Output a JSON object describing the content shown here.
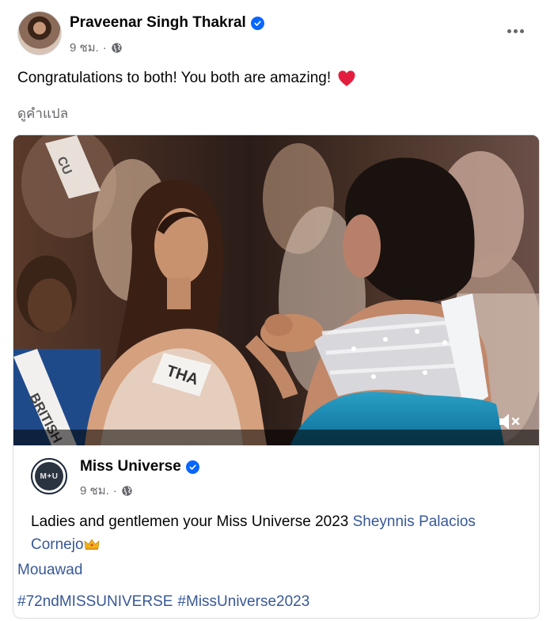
{
  "post": {
    "author": "Praveenar Singh Thakral",
    "time": "9 ชม.",
    "separator": "·",
    "text": "Congratulations to both! You both are amazing!",
    "translate_label": "ดูคำแปล"
  },
  "shared": {
    "author": "Miss Universe",
    "logo_text": "M+U",
    "time": "9 ชม.",
    "separator": "·",
    "text_plain": "Ladies and gentlemen your Miss Universe 2023 ",
    "link_name_part1": "Sheynnis Palacios",
    "link_name_part2": "Cornejo",
    "link_mouawad": "Mouawad",
    "hashtags": [
      "#72ndMISSUNIVERSE",
      "#MissUniverse2023"
    ]
  },
  "video": {
    "sash_left_text": "BRITISH",
    "sash_center_text": "THA",
    "sash_top_text": "CU"
  },
  "colors": {
    "verified_blue": "#0866ff",
    "link_blue": "#385898",
    "heart_red": "#e41e3f",
    "meta_gray": "#65676b"
  },
  "icons": {
    "verified": "verified-badge-icon",
    "globe": "globe-icon",
    "more": "more-options-icon",
    "heart": "red-heart-emoji",
    "crown": "crown-emoji",
    "mute": "speaker-muted-icon"
  }
}
